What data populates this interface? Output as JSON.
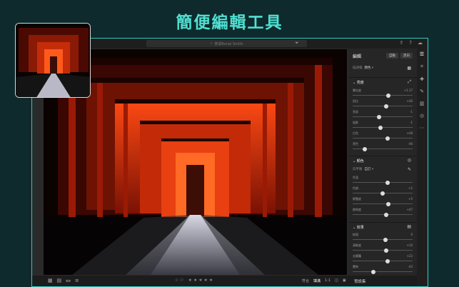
{
  "headline": "簡便編輯工具",
  "topbar": {
    "search_placeholder": "搜尋Bonal Smith",
    "icons": [
      "search-icon",
      "filter-icon",
      "share-icon",
      "help-icon",
      "cloud-icon"
    ]
  },
  "bottombar": {
    "view_icons": [
      "grid-icon",
      "square-grid-icon",
      "single-view-icon",
      "sort-icon"
    ],
    "rating_left": "☆ ⚐",
    "stars": "★ ★ ★ ★ ★",
    "fit_label": "符合",
    "fill_label": "填滿",
    "ratio_label": "1:1",
    "preset_button": "預設集"
  },
  "panel": {
    "title": "編輯",
    "auto_button": "自動",
    "bw_button": "黑白",
    "profile_label": "描述檔",
    "profile_value": "顏色",
    "light": {
      "title": "亮度",
      "sliders": [
        {
          "label": "曝光度",
          "value": "+1.17",
          "level": 0.59
        },
        {
          "label": "對比",
          "value": "+36",
          "level": 0.56
        },
        {
          "label": "亮部",
          "value": "-1",
          "level": 0.44
        },
        {
          "label": "陰影",
          "value": "-1",
          "level": 0.46
        },
        {
          "label": "白色",
          "value": "+48",
          "level": 0.58
        },
        {
          "label": "黑色",
          "value": "-46",
          "level": 0.2
        }
      ]
    },
    "color": {
      "title": "顏色",
      "wb_label": "白平衡",
      "wb_value": "自訂",
      "sliders": [
        {
          "label": "色溫",
          "value": "",
          "level": 0.58
        },
        {
          "label": "色調",
          "value": "+2",
          "level": 0.5
        },
        {
          "label": "鮮豔度",
          "value": "+5",
          "level": 0.6
        },
        {
          "label": "飽和度",
          "value": "+47",
          "level": 0.56
        }
      ]
    },
    "effects": {
      "title": "效果",
      "sliders": [
        {
          "label": "紋理",
          "value": "0",
          "level": 0.55
        },
        {
          "label": "清晰度",
          "value": "+10",
          "level": 0.56
        },
        {
          "label": "去朦朧",
          "value": "+23",
          "level": 0.58
        },
        {
          "label": "暈映",
          "value": "-43",
          "level": 0.35
        }
      ]
    }
  },
  "toolstrip": [
    "sliders-icon",
    "crop-icon",
    "healing-icon",
    "brush-icon",
    "gradient-icon",
    "radial-icon",
    "more-icon"
  ]
}
